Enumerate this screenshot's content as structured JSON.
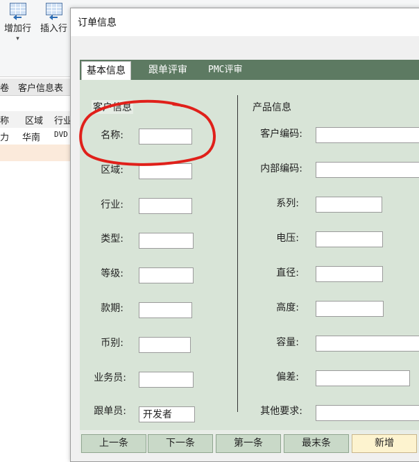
{
  "background": {
    "ribbon": {
      "add_row_label": "增加行",
      "insert_row_label": "插入行",
      "add_row_caret": "▾"
    },
    "sheet_tab_fragment": "卷",
    "sheet_tab": "客户信息表",
    "grid": {
      "headers": [
        "称",
        "区域",
        "行业"
      ],
      "row1": [
        "力",
        "华南",
        "DVD"
      ]
    }
  },
  "dialog": {
    "title": "订单信息",
    "tabs": [
      {
        "label": "基本信息",
        "active": true
      },
      {
        "label": "跟单评审",
        "active": false
      },
      {
        "label": "PMC评审",
        "active": false
      }
    ],
    "customer_group": {
      "title": "客户信息",
      "fields": [
        {
          "label": "名称:",
          "value": ""
        },
        {
          "label": "区域:",
          "value": ""
        },
        {
          "label": "行业:",
          "value": ""
        },
        {
          "label": "类型:",
          "value": ""
        },
        {
          "label": "等级:",
          "value": ""
        },
        {
          "label": "款期:",
          "value": ""
        },
        {
          "label": "币别:",
          "value": ""
        },
        {
          "label": "业务员:",
          "value": ""
        },
        {
          "label": "跟单员:",
          "value": "开发者"
        }
      ]
    },
    "product_group": {
      "title": "产品信息",
      "fields": [
        {
          "label": "客户编码:",
          "value": ""
        },
        {
          "label": "内部编码:",
          "value": ""
        },
        {
          "label": "系列:",
          "value": ""
        },
        {
          "label": "电压:",
          "value": ""
        },
        {
          "label": "直径:",
          "value": ""
        },
        {
          "label": "高度:",
          "value": ""
        },
        {
          "label": "容量:",
          "value": ""
        },
        {
          "label": "偏差:",
          "value": ""
        },
        {
          "label": "其他要求:",
          "value": ""
        }
      ]
    },
    "buttons": {
      "prev": "上一条",
      "next": "下一条",
      "first": "第一条",
      "last": "最末条",
      "add": "新增"
    }
  },
  "colors": {
    "panel_bg": "#d8e4d7",
    "tab_strip": "#5d7a62",
    "annotation": "#e0201a",
    "add_button": "#fdf3cf"
  }
}
